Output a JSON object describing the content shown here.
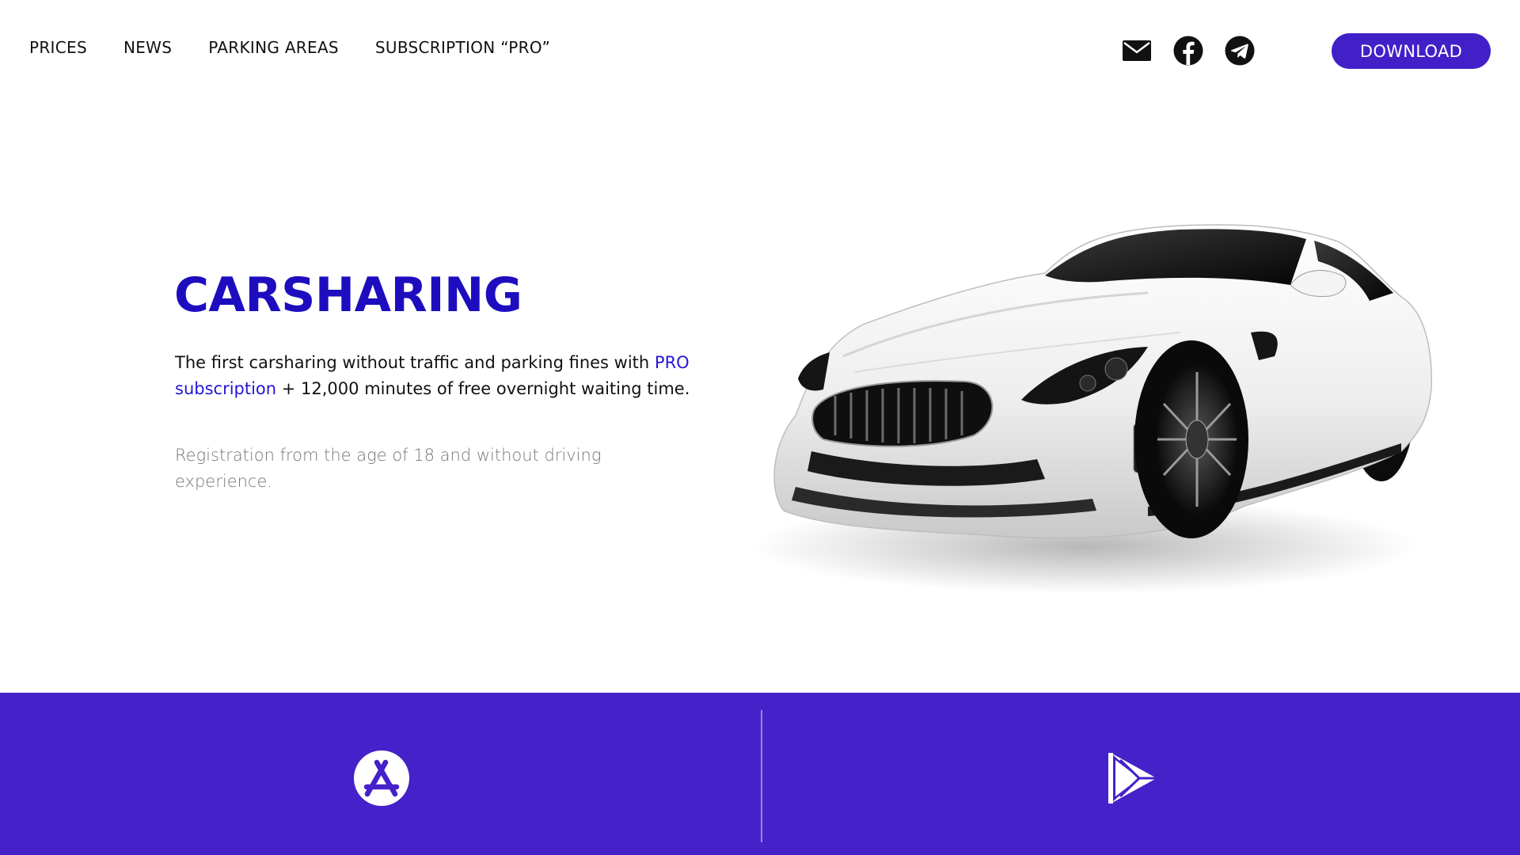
{
  "nav": {
    "items": [
      {
        "label": "PRICES"
      },
      {
        "label": "NEWS"
      },
      {
        "label": "PARKING AREAS"
      },
      {
        "label": "SUBSCRIPTION “PRO”"
      }
    ]
  },
  "socials": [
    {
      "icon": "mail-icon"
    },
    {
      "icon": "facebook-icon"
    },
    {
      "icon": "telegram-icon"
    }
  ],
  "download_label": "DOWNLOAD",
  "hero": {
    "title": "CARSHARING",
    "text_before_link": "The first carsharing without traffic and parking fines with ",
    "link_text": "PRO subscription",
    "text_after_link": " + 12,000 minutes of free overnight waiting time.",
    "sub_text": "Registration from the age of 18 and without driving experience."
  },
  "stores": {
    "appstore_icon": "app-store-icon",
    "playstore_icon": "google-play-icon"
  },
  "colors": {
    "accent": "#4220c8",
    "title": "#1e0dbf",
    "band": "#4421c9",
    "link": "#2616d6"
  }
}
